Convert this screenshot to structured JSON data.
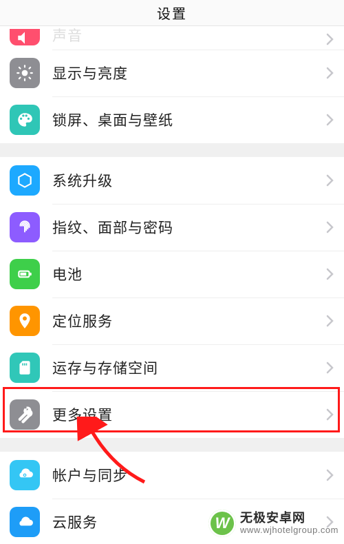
{
  "header": {
    "title": "设置"
  },
  "rows": {
    "sound": {
      "label": "声音"
    },
    "display": {
      "label": "显示与亮度"
    },
    "wallpaper": {
      "label": "锁屏、桌面与壁纸"
    },
    "update": {
      "label": "系统升级"
    },
    "biometric": {
      "label": "指纹、面部与密码"
    },
    "battery": {
      "label": "电池"
    },
    "location": {
      "label": "定位服务"
    },
    "storage": {
      "label": "运存与存储空间"
    },
    "more": {
      "label": "更多设置"
    },
    "account": {
      "label": "帐户与同步"
    },
    "cloud": {
      "label": "云服务"
    }
  },
  "watermark": {
    "brand": "无极安卓网",
    "url": "www.wjhotelgroup.com",
    "logo_text": "W"
  }
}
